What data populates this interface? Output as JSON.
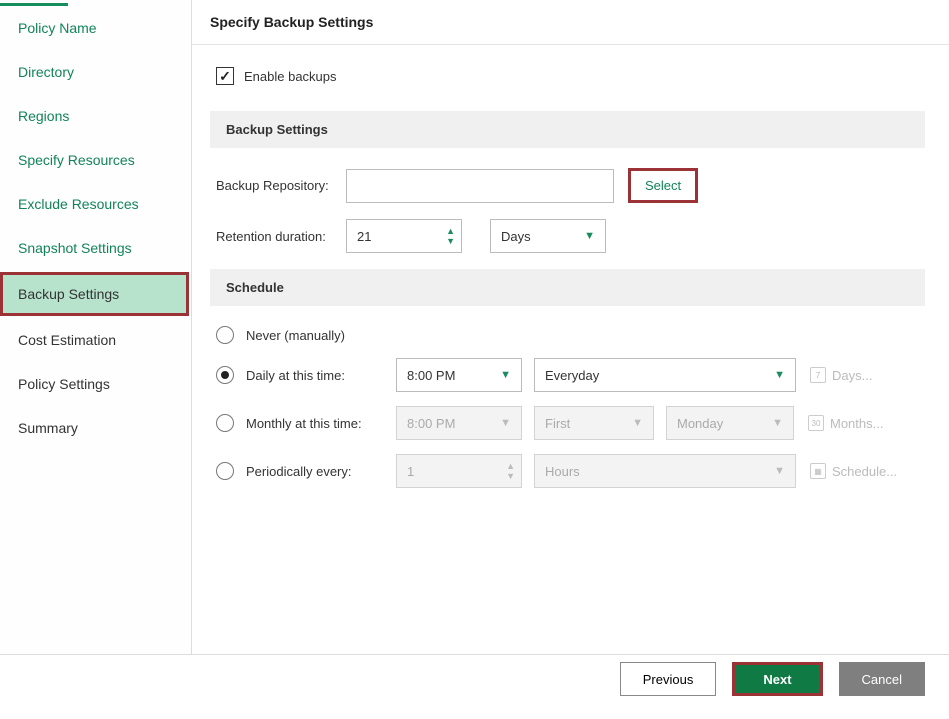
{
  "sidebar": {
    "items": [
      {
        "label": "Policy Name"
      },
      {
        "label": "Directory"
      },
      {
        "label": "Regions"
      },
      {
        "label": "Specify Resources"
      },
      {
        "label": "Exclude Resources"
      },
      {
        "label": "Snapshot Settings"
      },
      {
        "label": "Backup Settings"
      },
      {
        "label": "Cost Estimation"
      },
      {
        "label": "Policy Settings"
      },
      {
        "label": "Summary"
      }
    ]
  },
  "page": {
    "title": "Specify Backup Settings"
  },
  "enable_backups": {
    "label": "Enable backups",
    "checked": true
  },
  "section_backup_settings": {
    "title": "Backup Settings",
    "repository_label": "Backup Repository:",
    "repository_value": "",
    "select_label": "Select",
    "retention_label": "Retention duration:",
    "retention_value": "21",
    "retention_unit": "Days"
  },
  "section_schedule": {
    "title": "Schedule",
    "options": {
      "never": {
        "label": "Never (manually)",
        "checked": false
      },
      "daily": {
        "label": "Daily at this time:",
        "checked": true,
        "time": "8:00 PM",
        "frequency": "Everyday",
        "days_link": "Days..."
      },
      "monthly": {
        "label": "Monthly at this time:",
        "checked": false,
        "time": "8:00 PM",
        "ordinal": "First",
        "weekday": "Monday",
        "months_link": "Months..."
      },
      "periodically": {
        "label": "Periodically every:",
        "checked": false,
        "value": "1",
        "unit": "Hours",
        "schedule_link": "Schedule..."
      }
    }
  },
  "footer": {
    "previous": "Previous",
    "next": "Next",
    "cancel": "Cancel"
  },
  "icons": {
    "day7": "7",
    "day30": "30"
  }
}
